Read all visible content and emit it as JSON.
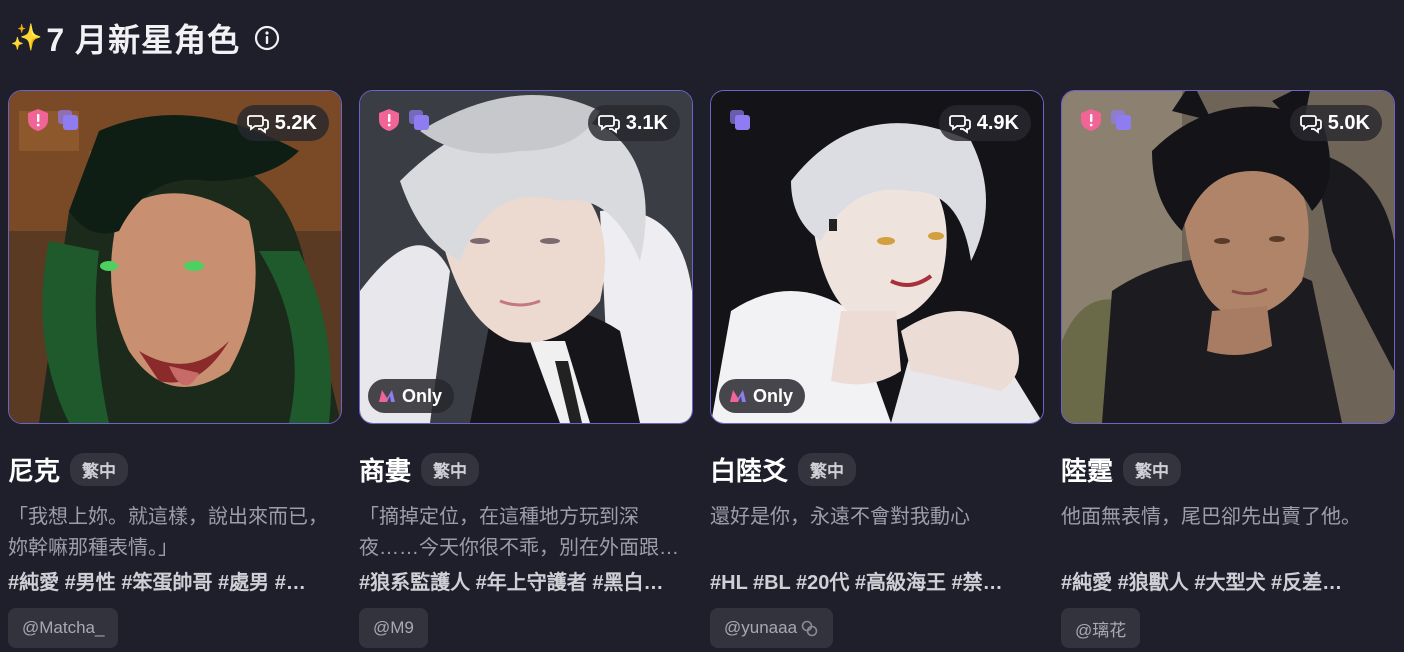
{
  "header": {
    "sparkle": "✨",
    "title": "7 月新星角色",
    "info_icon": "info-circle-icon"
  },
  "colors": {
    "background": "#1f1f2c",
    "card_border": "#6e64c8",
    "shield_badge": "#f06496",
    "copy_badge": "#8f7cf0",
    "m_logo_left": "#f06496",
    "m_logo_right": "#8f7cf0"
  },
  "cards": [
    {
      "count": "5.2K",
      "name": "尼克",
      "lang": "繁中",
      "desc": "「我想上妳。就這樣，說出來而已，妳幹嘛那種表情。」",
      "tags": "#純愛 #男性 #笨蛋帥哥 #處男 #…",
      "creator": "@Matcha_",
      "only": "",
      "badges": [
        "shield-icon",
        "copy-icon"
      ]
    },
    {
      "count": "3.1K",
      "name": "商婁",
      "lang": "繁中",
      "desc": "「摘掉定位，在這種地方玩到深夜……今天你很不乖，別在外面跟…",
      "tags": "#狼系監護人 #年上守護者 #黑白…",
      "creator": "@M9",
      "only": "Only",
      "badges": [
        "shield-icon",
        "copy-icon"
      ]
    },
    {
      "count": "4.9K",
      "name": "白陸爻",
      "lang": "繁中",
      "desc": "還好是你，永遠不會對我動心",
      "tags": "#HL #BL #20代 #高級海王 #禁…",
      "creator": "@yunaaa",
      "only": "Only",
      "badges": [
        "copy-icon"
      ]
    },
    {
      "count": "5.0K",
      "name": "陸霆",
      "lang": "繁中",
      "desc": "他面無表情，尾巴卻先出賣了他。",
      "tags": "#純愛 #狼獸人 #大型犬 #反差…",
      "creator": "@璃花",
      "only": "",
      "badges": [
        "shield-icon",
        "copy-icon"
      ]
    }
  ]
}
